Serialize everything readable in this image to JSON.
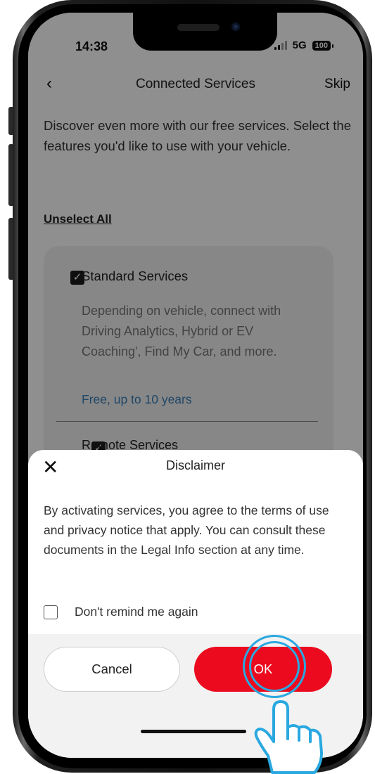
{
  "status_bar": {
    "time": "14:38",
    "network": "5G",
    "battery": "100"
  },
  "nav": {
    "back_icon": "chevron-left-icon",
    "title": "Connected Services",
    "skip_label": "Skip"
  },
  "intro_text": "Discover even more with our free services. Select the features you'd like to use with your vehicle.",
  "unselect_all_label": "Unselect All",
  "services": [
    {
      "title": "Standard Services",
      "checked": true,
      "description": "Depending on vehicle, connect with Driving Analytics, Hybrid or EV Coaching', Find My Car, and more.",
      "price": "Free, up to 10 years"
    },
    {
      "title": "Remote Services",
      "checked": true
    }
  ],
  "dialog": {
    "title": "Disclaimer",
    "close_icon": "close-icon",
    "body": "By activating services, you agree to the terms of use and privacy notice that apply. You can consult these documents in the Legal Info section at any time.",
    "remind_label": "Don't remind me again",
    "remind_checked": false,
    "cancel_label": "Cancel",
    "ok_label": "OK"
  },
  "colors": {
    "accent_red": "#eb0a1e",
    "link_blue": "#3a7fb8",
    "tap_ring": "#2aa8e0"
  }
}
